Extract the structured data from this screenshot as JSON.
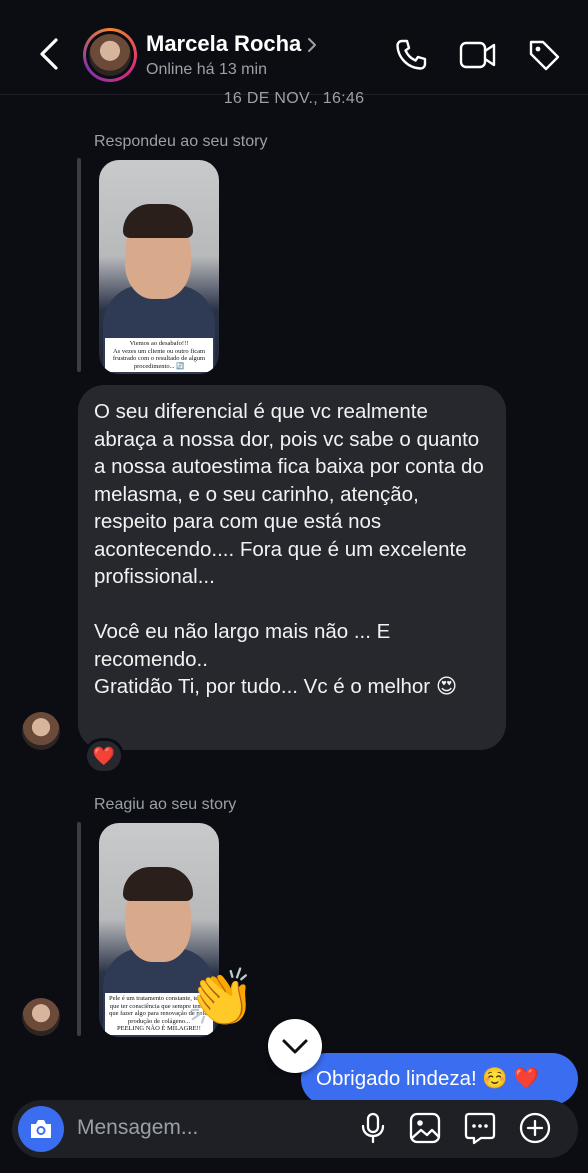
{
  "header": {
    "contact_name": "Marcela Rocha",
    "status": "Online há 13 min",
    "icons": [
      "back-icon",
      "chevron-right-icon",
      "phone-icon",
      "video-camera-icon",
      "tag-icon"
    ]
  },
  "date_divider": "16 DE NOV., 16:46",
  "thread": {
    "story_reply": {
      "context_label": "Respondeu ao seu story",
      "story_caption": "Viemos ao desabafo!!!\nAs vezes um cliente ou outro ficam frustrado com o resultado de algum procedimento... 🔄"
    },
    "message": {
      "text": "O seu diferencial é que vc realmente abraça a nossa dor, pois vc sabe o quanto a nossa autoestima fica baixa por conta do melasma, e o seu carinho, atenção, respeito para com que está nos acontecendo.... Fora que é um excelente profissional...\n\nVocê eu não largo mais não ... E recomendo..\nGratidão Ti, por tudo... Vc é o melhor 😍",
      "reaction": "❤️"
    },
    "story_reaction": {
      "context_label": "Reagiu ao seu story",
      "story_caption": "Pele é um tratamento constante, temos que ter consciência que sempre temos que fazer algo para renovação de pele, produção de colágeno...\nPEELING NÃO É MILAGRE!!",
      "reaction_emoji": "👏"
    },
    "sent_message": {
      "text": "Obrigado lindeza! ☺️ ❤️"
    }
  },
  "composer": {
    "placeholder": "Mensagem...",
    "icons": [
      "camera-icon",
      "microphone-icon",
      "gallery-icon",
      "chat-sticker-icon",
      "plus-icon"
    ]
  },
  "colors": {
    "background": "#0b0d12",
    "bubble_received": "#26282e",
    "bubble_sent": "#3a6df0",
    "secondary_text": "#9aa0a8"
  }
}
